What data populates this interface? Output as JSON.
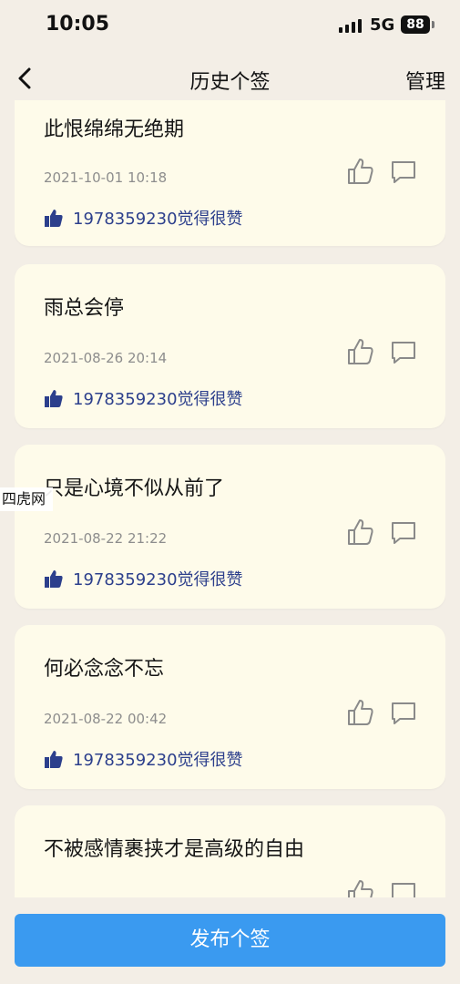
{
  "status_bar": {
    "time": "10:05",
    "network": "5G",
    "battery": "88"
  },
  "nav": {
    "title": "历史个签",
    "manage_label": "管理"
  },
  "cards": [
    {
      "text": "此恨绵绵无绝期",
      "time": "2021-10-01 10:18",
      "liker": "1978359230觉得很赞"
    },
    {
      "text": "雨总会停",
      "time": "2021-08-26 20:14",
      "liker": "1978359230觉得很赞"
    },
    {
      "text": "只是心境不似从前了",
      "time": "2021-08-22 21:22",
      "liker": "1978359230觉得很赞"
    },
    {
      "text": "何必念念不忘",
      "time": "2021-08-22 00:42",
      "liker": "1978359230觉得很赞"
    },
    {
      "text": "不被感情裹挟才是高级的自由",
      "time": "",
      "liker": ""
    }
  ],
  "watermark": "四虎网",
  "publish_label": "发布个签",
  "colors": {
    "accent": "#3a9af0",
    "card_bg": "#fefbea",
    "page_bg": "#f3eee6",
    "liker_text": "#2c3f8c"
  },
  "icons": {
    "like": "thumbs-up-outline-icon",
    "comment": "comment-bubble-icon",
    "liker": "thumbs-up-filled-icon",
    "back": "chevron-left-icon"
  }
}
